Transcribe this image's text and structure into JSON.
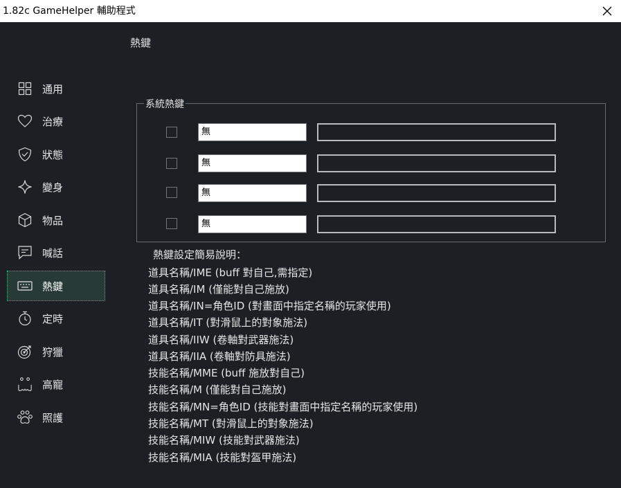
{
  "window": {
    "title": "1.82c GameHelper 輔助程式"
  },
  "page": {
    "title": "熱鍵"
  },
  "sidebar": {
    "items": [
      {
        "label": "通用",
        "icon": "grid-icon"
      },
      {
        "label": "治療",
        "icon": "heart-icon"
      },
      {
        "label": "狀態",
        "icon": "shield-icon"
      },
      {
        "label": "變身",
        "icon": "sparkle-icon"
      },
      {
        "label": "物品",
        "icon": "box-icon"
      },
      {
        "label": "喊話",
        "icon": "chat-icon"
      },
      {
        "label": "熱鍵",
        "icon": "keyboard-icon",
        "active": true
      },
      {
        "label": "定時",
        "icon": "stopwatch-icon"
      },
      {
        "label": "狩獵",
        "icon": "target-icon"
      },
      {
        "label": "高寵",
        "icon": "pet-face-icon"
      },
      {
        "label": "照護",
        "icon": "paw-icon"
      }
    ]
  },
  "hotkeys": {
    "group_title": "系統熱鍵",
    "rows": [
      {
        "checked": false,
        "key": "無",
        "item": ""
      },
      {
        "checked": false,
        "key": "無",
        "item": ""
      },
      {
        "checked": false,
        "key": "無",
        "item": ""
      },
      {
        "checked": false,
        "key": "無",
        "item": ""
      }
    ]
  },
  "help": {
    "title": "熱鍵設定簡易說明：",
    "lines": [
      "道具名稱/IME (buff 對自己,需指定)",
      "道具名稱/IM  (僅能對自己施放)",
      "道具名稱/IN=角色ID  (對畫面中指定名稱的玩家使用)",
      "道具名稱/IT  (對滑鼠上的對象施法)",
      "道具名稱/IIW (卷軸對武器施法)",
      "道具名稱/IIA (卷軸對防具施法)",
      "技能名稱/MME (buff 施放對自己)",
      "技能名稱/M   (僅能對自己施放)",
      "技能名稱/MN=角色ID  (技能對畫面中指定名稱的玩家使用)",
      "技能名稱/MT  (對滑鼠上的對象施法)",
      "技能名稱/MIW (技能對武器施法)",
      "技能名稱/MIA (技能對盔甲施法)"
    ]
  },
  "colors": {
    "background": "#1c1f23",
    "accent": "#28d79a",
    "text": "#e6e6e6"
  }
}
